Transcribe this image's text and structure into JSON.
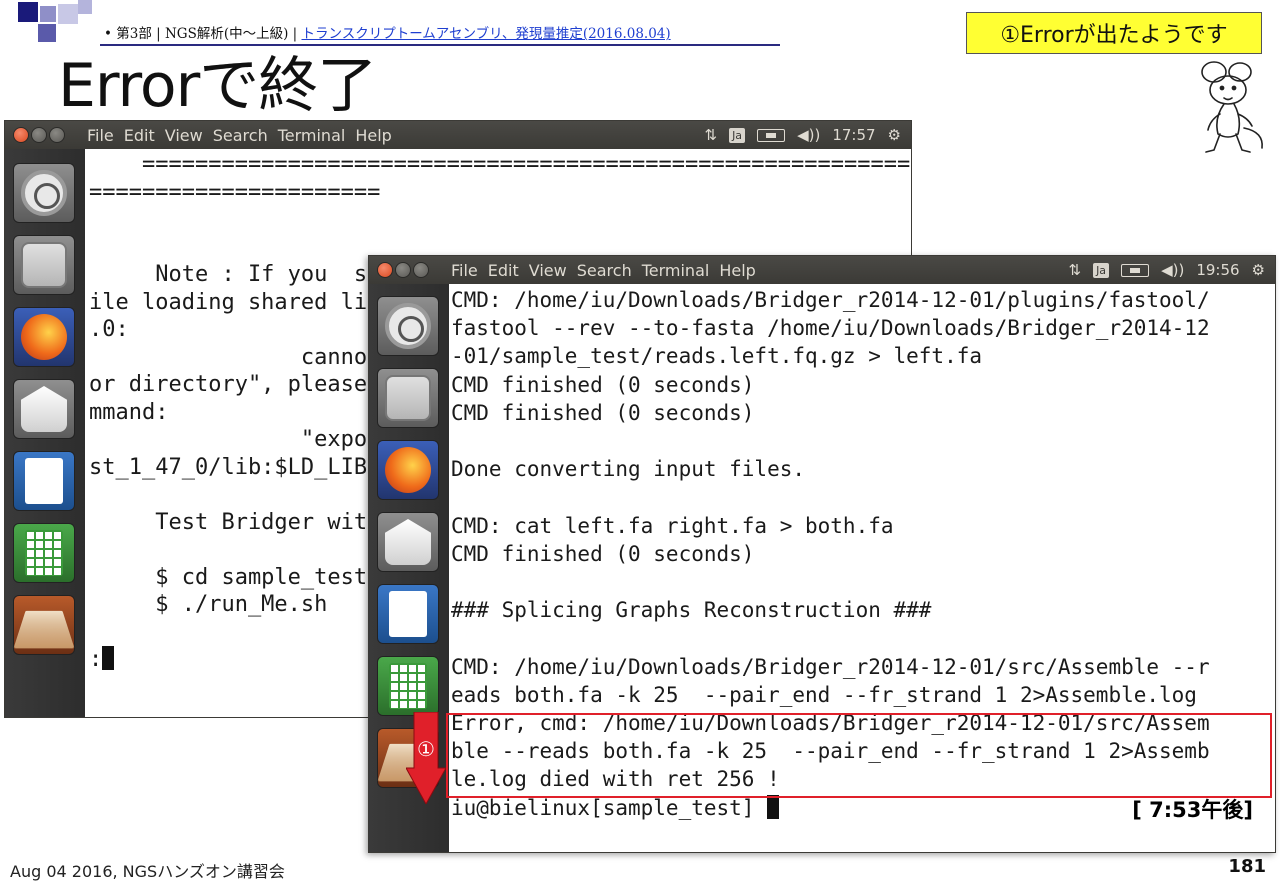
{
  "slide": {
    "breadcrumb_prefix": "• 第3部 | NGS解析(中～上級) | ",
    "breadcrumb_link": "トランスクリプトームアセンブリ、発現量推定(2016.08.04)",
    "title": "Errorで終了",
    "callout": "①Errorが出たようです",
    "marker_label": "①",
    "footer": "Aug 04 2016, NGSハンズオン講習会",
    "page_number": "181"
  },
  "back_window": {
    "menu": [
      "File",
      "Edit",
      "View",
      "Search",
      "Terminal",
      "Help"
    ],
    "time": "17:57",
    "keyboard_indicator": "Ja",
    "lines": [
      "    ==========================================================",
      "======================",
      "",
      "",
      "     Note : If you  s",
      "ile loading shared li",
      ".0:",
      "                cannot",
      "or directory\", please",
      "mmand:",
      "                \"export",
      "st_1_47_0/lib:$LD_LIB",
      "",
      "     Test Bridger wit",
      "",
      "     $ cd sample_test",
      "     $ ./run_Me.sh",
      "",
      ":"
    ]
  },
  "front_window": {
    "menu": [
      "File",
      "Edit",
      "View",
      "Search",
      "Terminal",
      "Help"
    ],
    "time": "19:56",
    "keyboard_indicator": "Ja",
    "lines": [
      "CMD: /home/iu/Downloads/Bridger_r2014-12-01/plugins/fastool/",
      "fastool --rev --to-fasta /home/iu/Downloads/Bridger_r2014-12",
      "-01/sample_test/reads.left.fq.gz > left.fa",
      "CMD finished (0 seconds)",
      "CMD finished (0 seconds)",
      "",
      "Done converting input files.",
      "",
      "CMD: cat left.fa right.fa > both.fa",
      "CMD finished (0 seconds)",
      "",
      "### Splicing Graphs Reconstruction ###",
      "",
      "CMD: /home/iu/Downloads/Bridger_r2014-12-01/src/Assemble --r",
      "eads both.fa -k 25  --pair_end --fr_strand 1 2>Assemble.log",
      "Error, cmd: /home/iu/Downloads/Bridger_r2014-12-01/src/Assem",
      "ble --reads both.fa -k 25  --pair_end --fr_strand 1 2>Assemb",
      "le.log died with ret 256 !",
      "iu@bielinux[sample_test] "
    ],
    "prompt_clock": "[ 7:53午後]"
  },
  "launcher_icons": [
    "ubuntu-dash",
    "files",
    "firefox",
    "mail",
    "writer",
    "calc",
    "workspaces"
  ],
  "colors": {
    "callout_bg": "#ffff33",
    "highlight_box": "#e0202a",
    "arrow": "#e0202a",
    "titlebar": "#3b3a36"
  }
}
